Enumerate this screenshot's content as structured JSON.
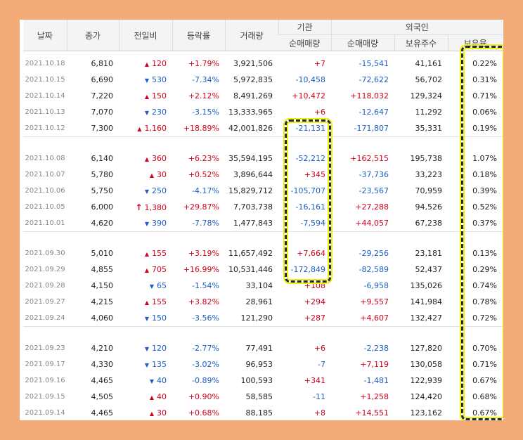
{
  "header": {
    "date": "날짜",
    "close": "종가",
    "change": "전일비",
    "rate": "등락률",
    "volume": "거래량",
    "institution": "기관",
    "foreign": "외국인",
    "inst_net": "순매매량",
    "foreign_net": "순매매량",
    "foreign_holdings": "보유주수",
    "foreign_ratio": "보유율"
  },
  "colors": {
    "up": "#d0021b",
    "down": "#1a5ec4",
    "highlight_border": "#1e2a4a",
    "highlight_glow": "#f4f200",
    "background": "#f3ab78"
  },
  "groups": [
    [
      {
        "date": "2021.10.18",
        "close": "6,810",
        "dir": "up",
        "change": "120",
        "rate": "+1.79%",
        "volume": "3,921,506",
        "inst": "+7",
        "fnet": "-15,541",
        "hold": "41,161",
        "ratio": "0.22%"
      },
      {
        "date": "2021.10.15",
        "close": "6,690",
        "dir": "down",
        "change": "530",
        "rate": "-7.34%",
        "volume": "5,972,835",
        "inst": "-10,458",
        "fnet": "-72,622",
        "hold": "56,702",
        "ratio": "0.31%"
      },
      {
        "date": "2021.10.14",
        "close": "7,220",
        "dir": "up",
        "change": "150",
        "rate": "+2.12%",
        "volume": "8,491,269",
        "inst": "+10,472",
        "fnet": "+118,032",
        "hold": "129,324",
        "ratio": "0.71%"
      },
      {
        "date": "2021.10.13",
        "close": "7,070",
        "dir": "down",
        "change": "230",
        "rate": "-3.15%",
        "volume": "13,333,965",
        "inst": "+6",
        "fnet": "-12,647",
        "hold": "11,292",
        "ratio": "0.06%"
      },
      {
        "date": "2021.10.12",
        "close": "7,300",
        "dir": "up",
        "change": "1,160",
        "rate": "+18.89%",
        "volume": "42,001,826",
        "inst": "-21,131",
        "fnet": "-171,807",
        "hold": "35,331",
        "ratio": "0.19%"
      }
    ],
    [
      {
        "date": "2021.10.08",
        "close": "6,140",
        "dir": "up",
        "change": "360",
        "rate": "+6.23%",
        "volume": "35,594,195",
        "inst": "-52,212",
        "fnet": "+162,515",
        "hold": "195,738",
        "ratio": "1.07%"
      },
      {
        "date": "2021.10.07",
        "close": "5,780",
        "dir": "up",
        "change": "30",
        "rate": "+0.52%",
        "volume": "3,896,644",
        "inst": "+345",
        "fnet": "-37,736",
        "hold": "33,223",
        "ratio": "0.18%"
      },
      {
        "date": "2021.10.06",
        "close": "5,750",
        "dir": "down",
        "change": "250",
        "rate": "-4.17%",
        "volume": "15,829,712",
        "inst": "-105,707",
        "fnet": "-23,567",
        "hold": "70,959",
        "ratio": "0.39%"
      },
      {
        "date": "2021.10.05",
        "close": "6,000",
        "dir": "limit",
        "change": "1,380",
        "rate": "+29.87%",
        "volume": "7,703,738",
        "inst": "-16,161",
        "fnet": "+27,288",
        "hold": "94,526",
        "ratio": "0.52%"
      },
      {
        "date": "2021.10.01",
        "close": "4,620",
        "dir": "down",
        "change": "390",
        "rate": "-7.78%",
        "volume": "1,477,843",
        "inst": "-7,594",
        "fnet": "+44,057",
        "hold": "67,238",
        "ratio": "0.37%"
      }
    ],
    [
      {
        "date": "2021.09.30",
        "close": "5,010",
        "dir": "up",
        "change": "155",
        "rate": "+3.19%",
        "volume": "11,657,492",
        "inst": "+7,664",
        "fnet": "-29,256",
        "hold": "23,181",
        "ratio": "0.13%"
      },
      {
        "date": "2021.09.29",
        "close": "4,855",
        "dir": "up",
        "change": "705",
        "rate": "+16.99%",
        "volume": "10,531,446",
        "inst": "-172,849",
        "fnet": "-82,589",
        "hold": "52,437",
        "ratio": "0.29%"
      },
      {
        "date": "2021.09.28",
        "close": "4,150",
        "dir": "down",
        "change": "65",
        "rate": "-1.54%",
        "volume": "33,104",
        "inst": "+108",
        "fnet": "-6,958",
        "hold": "135,026",
        "ratio": "0.74%"
      },
      {
        "date": "2021.09.27",
        "close": "4,215",
        "dir": "up",
        "change": "155",
        "rate": "+3.82%",
        "volume": "28,961",
        "inst": "+294",
        "fnet": "+9,557",
        "hold": "141,984",
        "ratio": "0.78%"
      },
      {
        "date": "2021.09.24",
        "close": "4,060",
        "dir": "down",
        "change": "150",
        "rate": "-3.56%",
        "volume": "121,290",
        "inst": "+287",
        "fnet": "+4,607",
        "hold": "132,427",
        "ratio": "0.72%"
      }
    ],
    [
      {
        "date": "2021.09.23",
        "close": "4,210",
        "dir": "down",
        "change": "120",
        "rate": "-2.77%",
        "volume": "77,491",
        "inst": "+6",
        "fnet": "-2,238",
        "hold": "127,820",
        "ratio": "0.70%"
      },
      {
        "date": "2021.09.17",
        "close": "4,330",
        "dir": "down",
        "change": "135",
        "rate": "-3.02%",
        "volume": "96,953",
        "inst": "-7",
        "fnet": "+7,119",
        "hold": "130,058",
        "ratio": "0.71%"
      },
      {
        "date": "2021.09.16",
        "close": "4,465",
        "dir": "down",
        "change": "40",
        "rate": "-0.89%",
        "volume": "100,593",
        "inst": "+341",
        "fnet": "-1,481",
        "hold": "122,939",
        "ratio": "0.67%"
      },
      {
        "date": "2021.09.15",
        "close": "4,505",
        "dir": "up",
        "change": "40",
        "rate": "+0.90%",
        "volume": "58,585",
        "inst": "-11",
        "fnet": "+1,258",
        "hold": "124,420",
        "ratio": "0.68%"
      },
      {
        "date": "2021.09.14",
        "close": "4,465",
        "dir": "up",
        "change": "30",
        "rate": "+0.68%",
        "volume": "88,185",
        "inst": "+8",
        "fnet": "+14,551",
        "hold": "123,162",
        "ratio": "0.67%"
      }
    ]
  ]
}
